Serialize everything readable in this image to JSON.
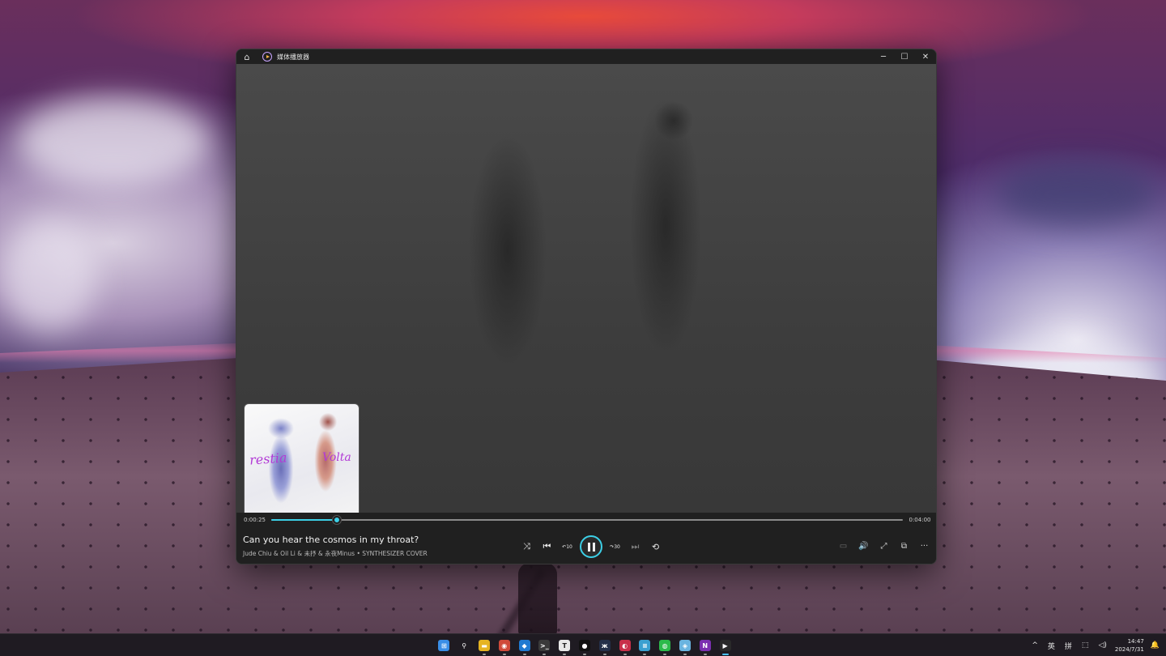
{
  "window": {
    "title": "媒体播放器",
    "home_icon": "home-icon",
    "app_icon": "media-player-icon",
    "controls": {
      "minimize": "─",
      "maximize": "☐",
      "close": "✕"
    }
  },
  "album_art": {
    "script_left": "restia",
    "script_right": "Volta"
  },
  "playback": {
    "elapsed": "0:00:25",
    "duration": "0:04:00",
    "progress_fraction": 0.1042
  },
  "now_playing": {
    "title": "Can you hear the cosmos in my throat?",
    "artist_line": "Jude Chiu & Oil Li & 未抒 & 永夜Minus • SYNTHESIZER COVER"
  },
  "controls": {
    "shuffle": "⤨",
    "previous": "⏮",
    "rewind_label": "10",
    "forward_label": "30",
    "next": "⏭",
    "repeat": "⟲"
  },
  "right_controls": {
    "subtitles": "▭",
    "volume": "🔊",
    "fullscreen": "⤢",
    "miniplayer": "⧉",
    "more": "···"
  },
  "taskbar": {
    "apps": [
      {
        "name": "start",
        "glyph": "⊞",
        "color": "#3a8ee6",
        "running": false
      },
      {
        "name": "search",
        "glyph": "⚲",
        "color": "transparent",
        "running": false
      },
      {
        "name": "file-explorer",
        "glyph": "▬",
        "color": "#e6b422",
        "running": true
      },
      {
        "name": "chrome",
        "glyph": "◉",
        "color": "#d04a3a",
        "running": true
      },
      {
        "name": "vscode",
        "glyph": "◆",
        "color": "#1f7ad1",
        "running": true
      },
      {
        "name": "terminal",
        "glyph": ">_",
        "color": "#3a3a3a",
        "running": true
      },
      {
        "name": "typora",
        "glyph": "T",
        "color": "#e8e8e8",
        "running": true
      },
      {
        "name": "qq",
        "glyph": "●",
        "color": "#111111",
        "running": true
      },
      {
        "name": "app-9",
        "glyph": "ж",
        "color": "#24304a",
        "running": true
      },
      {
        "name": "app-10",
        "glyph": "◐",
        "color": "#c8304a",
        "running": true
      },
      {
        "name": "notepad",
        "glyph": "≡",
        "color": "#3aa0d0",
        "running": true
      },
      {
        "name": "wechat",
        "glyph": "◍",
        "color": "#2cba4a",
        "running": true
      },
      {
        "name": "app-13",
        "glyph": "◈",
        "color": "#6ab4e0",
        "running": true
      },
      {
        "name": "onenote",
        "glyph": "N",
        "color": "#7b2fb0",
        "running": true
      },
      {
        "name": "media-player",
        "glyph": "▶",
        "color": "#2a2a2a",
        "running": true,
        "active": true
      }
    ],
    "tray": {
      "chevron": "^",
      "ime_lang": "英",
      "ime_mode": "拼",
      "network_icon": "⬚",
      "volume_icon": "◁)",
      "time": "14:47",
      "date": "2024/7/31",
      "notification_icon": "🔔"
    }
  }
}
